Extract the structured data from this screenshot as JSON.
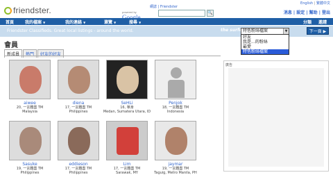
{
  "lang_links": {
    "english": "English",
    "chinese": "繁體中文"
  },
  "logo": {
    "text": "friendster."
  },
  "search": {
    "top_link_1": "網誌",
    "top_link_2": "Friendster",
    "powered_by": "powered by",
    "google": "Google",
    "placeholder": "",
    "go": "🔍"
  },
  "user_links": [
    "消息",
    "設定",
    "幫助",
    "登出"
  ],
  "nav": {
    "items": [
      "首頁",
      "我的檔案",
      "我的連絡",
      "瀏覽",
      "搜尋"
    ],
    "right": [
      "分類",
      "邀請"
    ]
  },
  "subbar": {
    "classified": "Friendster Classifieds. Great local listings - around the world.",
    "surfer": "the surfer",
    "selected": "特色粉絲檔案",
    "next": "下一頁"
  },
  "dropdown_options": [
    "好友",
    "我是...的粉絲",
    "最愛",
    "特色粉絲檔案"
  ],
  "page_title": "會員",
  "tabs": [
    "新成員",
    "熱門",
    "好友的好友"
  ],
  "members": [
    {
      "name": "aiwee",
      "age": "20, 一言難盡 TM",
      "loc": "Malaysia",
      "color": "#c97b6a"
    },
    {
      "name": "diena",
      "age": "17, 一言難盡 TM",
      "loc": "Philippines",
      "color": "#b58b74"
    },
    {
      "name": "SeHLi",
      "age": "16, 單身",
      "loc": "Medan, Sumatera Utara, ID",
      "color": "#d9c3a5"
    },
    {
      "name": "Penjok",
      "age": "18, 一言難盡 TM",
      "loc": "Indonesia",
      "color": "#ddd"
    },
    {
      "name": "Sasuke",
      "age": "19, 一言難盡 TM",
      "loc": "Philippines",
      "color": "#a98a7a"
    },
    {
      "name": "eddieson",
      "age": "17, 一言難盡 TM",
      "loc": "Philippines",
      "color": "#8a6a5a"
    },
    {
      "name": "Lim",
      "age": "17, 一言難盡 TM",
      "loc": "Sarawak, MY",
      "color": "#d2403a"
    },
    {
      "name": "jaymar",
      "age": "19, 一言難盡 TM",
      "loc": "Taguig, Metro Manila, PH",
      "color": "#b0826a"
    }
  ],
  "ad_label": "廣告"
}
